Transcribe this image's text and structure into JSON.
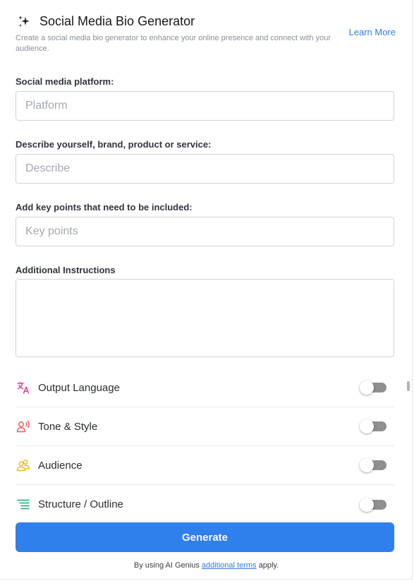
{
  "header": {
    "title": "Social Media Bio Generator",
    "subtitle": "Create a social media bio generator to enhance your online presence and connect with your audience.",
    "learn_more": "Learn More"
  },
  "fields": {
    "platform": {
      "label": "Social media platform:",
      "placeholder": "Platform"
    },
    "describe": {
      "label": "Describe yourself, brand, product or service:",
      "placeholder": "Describe"
    },
    "key_points": {
      "label": "Add key points that need to be included:",
      "placeholder": "Key points"
    },
    "instructions": {
      "label": "Additional Instructions",
      "placeholder": ""
    }
  },
  "options": [
    {
      "label": "Output Language",
      "icon": "translate-icon",
      "color": "#e0409a",
      "enabled": false
    },
    {
      "label": "Tone & Style",
      "icon": "speaking-person-icon",
      "color": "#ef5b5b",
      "enabled": false
    },
    {
      "label": "Audience",
      "icon": "group-icon",
      "color": "#f1b81c",
      "enabled": false
    },
    {
      "label": "Structure / Outline",
      "icon": "outline-list-icon",
      "color": "#18a86b",
      "enabled": false
    }
  ],
  "generate_label": "Generate",
  "footer": {
    "prefix": "By using AI Genius ",
    "link": "additional terms",
    "suffix": " apply."
  },
  "colors": {
    "accent": "#2f7fec",
    "link": "#2f7be5"
  }
}
